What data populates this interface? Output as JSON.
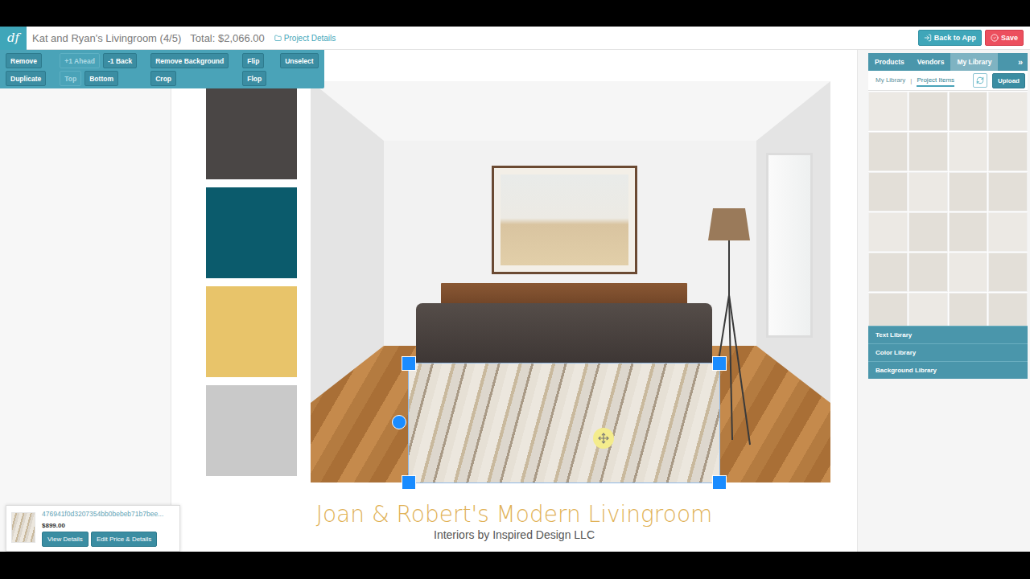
{
  "app": {
    "logo": "df",
    "title": "Kat and Ryan's Livingroom (4/5)",
    "total": "Total: $2,066.00",
    "project_details": "Project Details",
    "back_button": "Back to App",
    "save_button": "Save"
  },
  "toolbar": {
    "groups": [
      {
        "rows": [
          [
            {
              "label": "Remove",
              "disabled": false
            }
          ],
          [
            {
              "label": "Duplicate",
              "disabled": false
            }
          ]
        ]
      },
      {
        "rows": [
          [
            {
              "label": "+1 Ahead",
              "disabled": true
            },
            {
              "label": "-1 Back",
              "disabled": false
            }
          ],
          [
            {
              "label": "Top",
              "disabled": true
            },
            {
              "label": "Bottom",
              "disabled": false
            }
          ]
        ]
      },
      {
        "rows": [
          [
            {
              "label": "Remove Background",
              "disabled": false
            }
          ],
          [
            {
              "label": "Crop",
              "disabled": false
            }
          ]
        ]
      },
      {
        "rows": [
          [
            {
              "label": "Flip",
              "disabled": false
            }
          ],
          [
            {
              "label": "Flop",
              "disabled": false
            }
          ]
        ]
      },
      {
        "rows": [
          [
            {
              "label": "Unselect",
              "disabled": false
            }
          ]
        ]
      }
    ]
  },
  "palette": [
    {
      "color": "#4a4645"
    },
    {
      "color": "#0b5b6c"
    },
    {
      "color": "#e8c46a"
    },
    {
      "color": "#c9c9c9"
    }
  ],
  "canvas": {
    "selection_active": true,
    "title": "Joan & Robert's Modern Livingroom",
    "subtitle": "Interiors by Inspired Design LLC"
  },
  "selected_item": {
    "id": "476941f0d3207354bb0bebeb71b7bee...",
    "price": "$899.00",
    "buttons": [
      "View Details",
      "Edit Price & Details"
    ]
  },
  "library": {
    "tabs": [
      {
        "label": "Products",
        "selected": false
      },
      {
        "label": "Vendors",
        "selected": false
      },
      {
        "label": "My Library",
        "selected": true
      }
    ],
    "collapse": "»",
    "subtabs": [
      {
        "label": "My Library",
        "selected": false
      },
      {
        "label": "Project Items",
        "selected": true
      }
    ],
    "separator": "|",
    "upload": "Upload",
    "items": [
      {
        "selected": false
      },
      {
        "selected": false
      },
      {
        "selected": false
      },
      {
        "selected": false
      },
      {
        "selected": false
      },
      {
        "selected": false
      },
      {
        "selected": false
      },
      {
        "selected": false
      },
      {
        "selected": false
      },
      {
        "selected": false
      },
      {
        "selected": false
      },
      {
        "selected": false
      },
      {
        "selected": false
      },
      {
        "selected": false
      },
      {
        "selected": false
      },
      {
        "selected": false
      },
      {
        "selected": false
      },
      {
        "selected": false
      },
      {
        "selected": false
      },
      {
        "selected": false
      },
      {
        "selected": false
      },
      {
        "selected": false
      },
      {
        "selected": false
      },
      {
        "selected": false
      }
    ],
    "sections": [
      {
        "label": "Text Library",
        "expanded": false
      },
      {
        "label": "Color Library",
        "expanded": false
      },
      {
        "label": "Background Library",
        "expanded": false
      }
    ]
  }
}
